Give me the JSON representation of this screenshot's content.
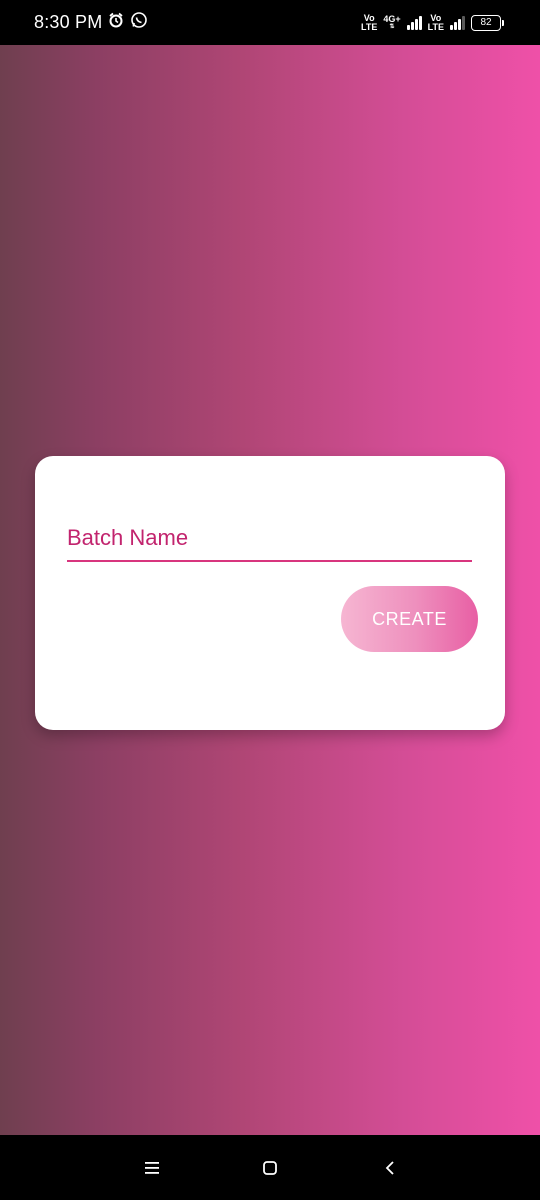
{
  "status_bar": {
    "time": "8:30 PM",
    "icons": [
      "alarm-icon",
      "whatsapp-icon"
    ],
    "net1_top": "Vo",
    "net1_bottom": "LTE",
    "net1_type": "4G+",
    "net2_top": "Vo",
    "net2_bottom": "LTE",
    "battery": "82"
  },
  "form": {
    "batch_name_placeholder": "Batch Name",
    "batch_name_value": "",
    "create_label": "CREATE"
  },
  "colors": {
    "accent": "#d8357e",
    "gradient_left": "#6f3f4f",
    "gradient_right": "#ef50a8"
  },
  "nav_bar": {
    "buttons": [
      "menu-icon",
      "home-icon",
      "back-icon"
    ]
  }
}
